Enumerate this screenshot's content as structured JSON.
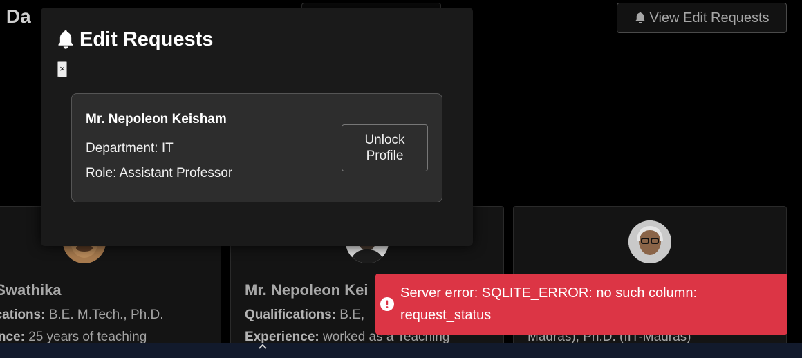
{
  "header": {
    "title": "n Da",
    "view_requests_label": "View Edit Requests"
  },
  "cards": [
    {
      "name": ". Swathika",
      "qual_label": "fications:",
      "qual_value": " B.E. M.Tech., Ph.D.",
      "exp_label": "ience:",
      "exp_value": " 25 years of teaching"
    },
    {
      "name": "Mr. Nepoleon Kei",
      "qual_label": "Qualifications:",
      "qual_value": " B.E,",
      "exp_label": "Experience:",
      "exp_value": " worked as a Teaching"
    },
    {
      "extra_line": "Madras), Ph.D. (IIT-Madras)"
    }
  ],
  "modal": {
    "title": "Edit Requests",
    "close_label": "×",
    "request": {
      "name": "Mr. Nepoleon Keisham",
      "department": "Department: IT",
      "role": "Role: Assistant Professor",
      "unlock_label": "Unlock Profile"
    }
  },
  "toast": {
    "message": "Server error: SQLITE_ERROR: no such column: request_status"
  },
  "colors": {
    "toast_bg": "#dc3545",
    "modal_bg": "#1a1a1a",
    "request_card_bg": "#2d2d2d"
  }
}
